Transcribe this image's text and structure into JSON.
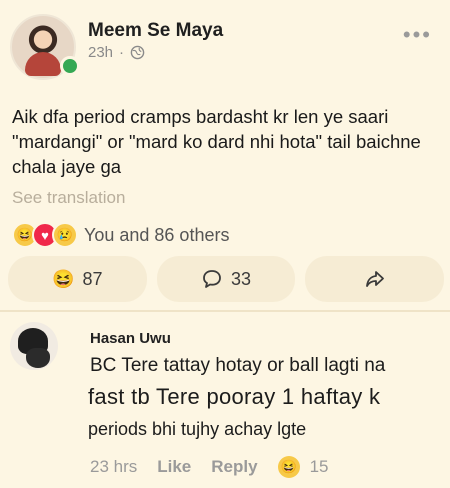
{
  "post": {
    "author": "Meem Se Maya",
    "time": "23h",
    "dot": "·",
    "text": "Aik dfa period cramps bardasht kr len ye saari \"mardangi\" or \"mard ko dard nhi hota\" tail baichne chala jaye ga",
    "see_translation": "See translation",
    "reactions_text": "You and 86 others",
    "reaction_icons": [
      "haha-icon",
      "love-icon",
      "sad-icon"
    ],
    "more": "•••"
  },
  "actions": {
    "react_count": "87",
    "comment_count": "33",
    "share_icon": "share-arrow-icon"
  },
  "comment": {
    "author": "Hasan Uwu",
    "line1": "BC Tere tattay hotay or ball lagti na",
    "line2": "fast tb Tere pooray 1 haftay k",
    "line3": "periods bhi tujhy achay lgte",
    "time": "23 hrs",
    "like": "Like",
    "reply": "Reply",
    "react_count": "15"
  },
  "colors": {
    "background": "#fdf6e3",
    "button_bg": "#f6ecd4",
    "online": "#35a853",
    "muted": "#9a9a9a"
  }
}
